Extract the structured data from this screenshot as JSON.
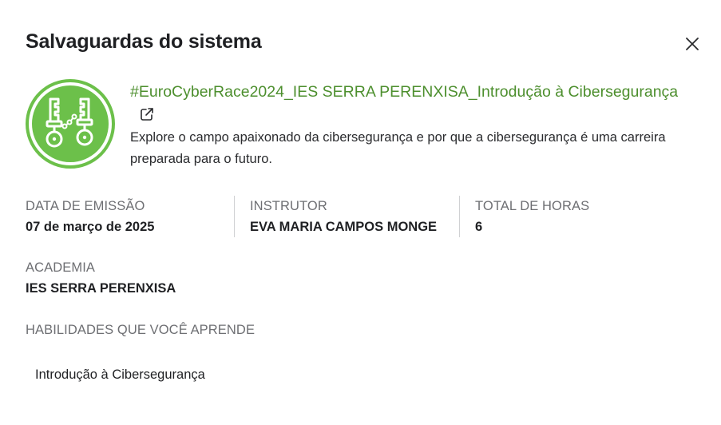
{
  "dialog": {
    "title": "Salvaguardas do sistema",
    "close_icon": "close-icon"
  },
  "course": {
    "badge_icon": "keys-badge-icon",
    "badge_color": "#6cc04a",
    "link_text": "#EuroCyberRace2024_IES SERRA PERENXISA_Introdução à Cibersegurança",
    "link_color": "#4d8f2e",
    "external_link_icon": "external-link-icon",
    "description": "Explore o campo apaixonado da cibersegurança e por que a cibersegurança é uma carreira preparada para o futuro."
  },
  "details": {
    "issue_date": {
      "label": "DATA DE EMISSÃO",
      "value": "07 de março de 2025"
    },
    "instructor": {
      "label": "INSTRUTOR",
      "value": "EVA MARIA CAMPOS MONGE"
    },
    "total_hours": {
      "label": "TOTAL DE HORAS",
      "value": "6"
    },
    "academy": {
      "label": "ACADEMIA",
      "value": "IES SERRA PERENXISA"
    }
  },
  "skills": {
    "label": "HABILIDADES QUE VOCÊ APRENDE",
    "items": [
      "Introdução à Cibersegurança"
    ]
  }
}
